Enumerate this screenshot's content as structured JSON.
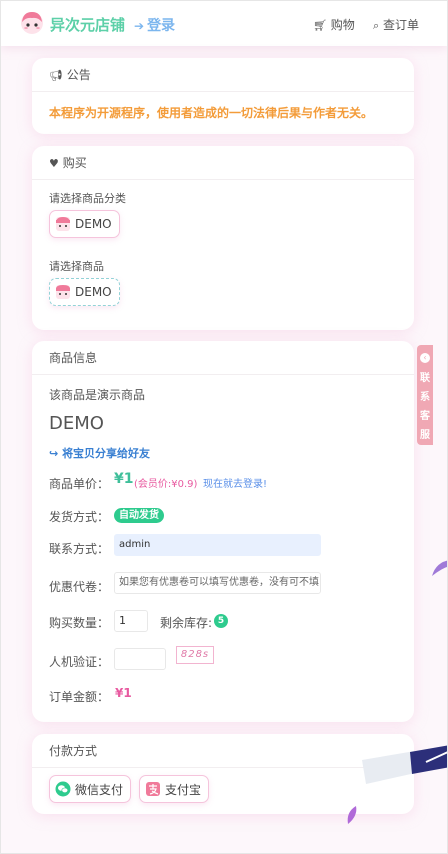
{
  "header": {
    "brand": "异次元店铺",
    "login": "登录",
    "nav": [
      {
        "label": "购物"
      },
      {
        "label": "查订单"
      }
    ]
  },
  "notice": {
    "title": "公告",
    "text": "本程序为开源程序，使用者造成的一切法律后果与作者无关。"
  },
  "buy": {
    "title": "购买",
    "category_label": "请选择商品分类",
    "category": "DEMO",
    "product_label": "请选择商品",
    "product": "DEMO"
  },
  "product": {
    "title": "商品信息",
    "desc": "该商品是演示商品",
    "name": "DEMO",
    "share": "将宝贝分享给好友",
    "price_label": "商品单价：",
    "price": "¥1",
    "member_price": "(会员价:¥0.9)",
    "login_link": "现在就去登录!",
    "delivery_label": "发货方式：",
    "delivery": "自动发货",
    "contact_label": "联系方式：",
    "contact_value": "admin",
    "coupon_label": "优惠代卷：",
    "coupon_placeholder": "如果您有优惠卷可以填写优惠卷，没有可不填",
    "qty_label": "购买数量：",
    "qty_value": "1",
    "stock_label": "剩余库存:",
    "stock": "5",
    "captcha_label": "人机验证：",
    "captcha_code": "828s",
    "total_label": "订单金额：",
    "total": "¥1"
  },
  "payment": {
    "title": "付款方式",
    "methods": [
      {
        "label": "微信支付"
      },
      {
        "label": "支付宝"
      }
    ]
  },
  "side": {
    "text": "联系客服"
  },
  "colors": {
    "accent_green": "#5dd0a8",
    "notice_orange": "#f39c3a",
    "pink": "#e85aa0",
    "link_blue": "#5a8fe8",
    "side_pink": "#f0a8b4"
  }
}
